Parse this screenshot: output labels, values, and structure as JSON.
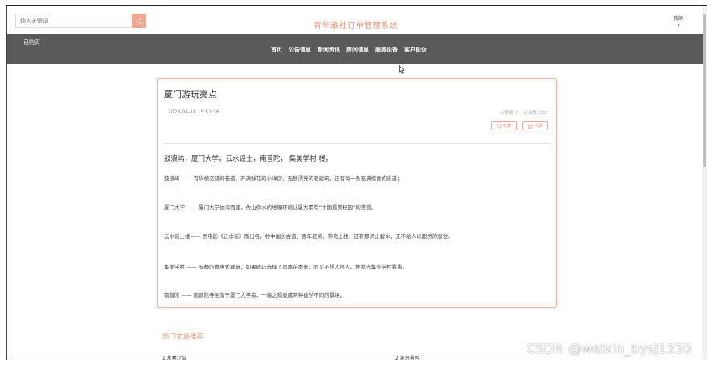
{
  "header": {
    "search_placeholder": "输入关键词",
    "site_title": "青年旅社订单管理系统",
    "mine_label": "我的",
    "mine_caret": "▾"
  },
  "navbar": {
    "cart_label": "已购买",
    "items": [
      "首页",
      "公告信息",
      "新闻资讯",
      "房间信息",
      "服务设备",
      "客户投诉"
    ]
  },
  "article": {
    "title": "厦门游玩亮点",
    "date": "2023-04-18 15:51:16",
    "likes_label": "点赞数: 0",
    "clicks_label": "点击数: 201",
    "collect_label": "收藏",
    "like_label": "点赞",
    "lead": "鼓浪屿，厦门大学，云水谣土，南普陀， 集美学村 楼，",
    "paragraphs": [
      "鼓浪屿 —— 有纵横交错的巷道、开满鲜花的小洋房、无数漂亮的老建筑，还有每一条充满惊喜的街道；",
      "厦门大学 —— 厦门大学依海而建，依山傍水的地理环境让厦大素有“中国最美校园”的美誉。",
      "云水谣土楼—— 因电影《云水谣》而出名，村中幽长古道、百年老榕、神奇土楼，还有那灵山碧水，无不给人以超然的感觉。",
      "集美学村 —— 安静的嘉庚式建筑，如果碰巧选择了凤凰花季来，而又不想人挤人，推荐去集美学村看看。",
      "南普陀 —— 南普陀寺坐落于厦门大学旁，一墙之隔竟成两种截然不同的景境。"
    ]
  },
  "hot": {
    "title": "热门文章推荐",
    "items": [
      "1 永春介绍",
      "2 泉州景色"
    ]
  },
  "watermark": "CSDN @weixin_bysj1330",
  "colors": {
    "accent": "#e9967a",
    "navbar": "#5a5a5a",
    "card_border": "#f0b3a2"
  }
}
